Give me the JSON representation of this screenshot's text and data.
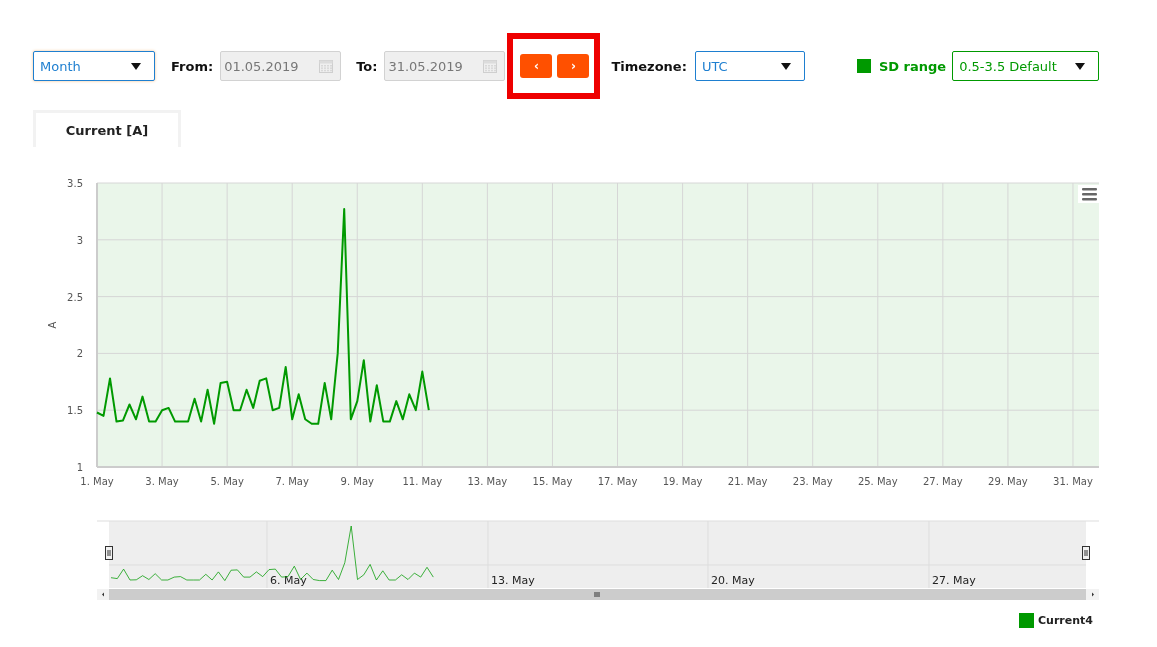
{
  "toolbar": {
    "period": {
      "value": "Month"
    },
    "from": {
      "label": "From:",
      "value": "01.05.2019"
    },
    "to": {
      "label": "To:",
      "value": "31.05.2019"
    },
    "nav_buttons": [
      {
        "label": "‹"
      },
      {
        "label": "›"
      }
    ],
    "annotation": {
      "kind": "frame",
      "color": "#ee0000"
    },
    "timezone": {
      "label": "Timezone:",
      "value": "UTC"
    },
    "sd_range": {
      "label": "SD range",
      "color": "#009900",
      "value": "0.5-3.5 Default"
    }
  },
  "tabs": [
    {
      "label": "Current [A]",
      "selected": true
    }
  ],
  "main_chart": {
    "chart_data": {
      "type": "line",
      "grid": true,
      "ylabel": "A",
      "ylim": [
        1,
        3.5
      ],
      "yticks": [
        1,
        1.5,
        2,
        2.5,
        3,
        3.5
      ],
      "categories": [
        "1. May",
        null,
        null,
        null,
        null,
        null,
        null,
        null,
        null,
        null,
        "3. May",
        null,
        null,
        null,
        null,
        null,
        null,
        null,
        null,
        null,
        "5. May",
        null,
        null,
        null,
        null,
        null,
        null,
        null,
        null,
        null,
        "7. May",
        null,
        null,
        null,
        null,
        null,
        null,
        null,
        null,
        null,
        "9. May",
        null,
        null,
        null,
        null,
        null,
        null,
        null,
        null,
        null,
        "11. May",
        null,
        null,
        null,
        null,
        null,
        null,
        null,
        null,
        null,
        "13. May",
        null,
        null,
        null,
        null,
        null,
        null,
        null,
        null,
        null,
        "15. May",
        null,
        null,
        null,
        null,
        null,
        null,
        null,
        null,
        null,
        "17. May",
        null,
        null,
        null,
        null,
        null,
        null,
        null,
        null,
        null,
        "19. May",
        null,
        null,
        null,
        null,
        null,
        null,
        null,
        null,
        null,
        "21. May",
        null,
        null,
        null,
        null,
        null,
        null,
        null,
        null,
        null,
        "23. May",
        null,
        null,
        null,
        null,
        null,
        null,
        null,
        null,
        null,
        "25. May",
        null,
        null,
        null,
        null,
        null,
        null,
        null,
        null,
        null,
        "27. May",
        null,
        null,
        null,
        null,
        null,
        null,
        null,
        null,
        null,
        "29. May",
        null,
        null,
        null,
        null,
        null,
        null,
        null,
        null,
        null,
        "31. May",
        null,
        null,
        null,
        null
      ],
      "series": [
        {
          "name": "Current4",
          "color": "#009900",
          "values": [
            1.48,
            1.45,
            1.78,
            1.4,
            1.41,
            1.55,
            1.42,
            1.62,
            1.4,
            1.4,
            1.5,
            1.52,
            1.4,
            1.4,
            1.4,
            1.6,
            1.4,
            1.68,
            1.38,
            1.74,
            1.75,
            1.5,
            1.5,
            1.68,
            1.52,
            1.76,
            1.78,
            1.5,
            1.52,
            1.88,
            1.42,
            1.64,
            1.42,
            1.38,
            1.38,
            1.74,
            1.42,
            2.0,
            3.27,
            1.42,
            1.58,
            1.94,
            1.4,
            1.72,
            1.4,
            1.4,
            1.58,
            1.42,
            1.64,
            1.5,
            1.84,
            1.5,
            null,
            null,
            null,
            null,
            null,
            null,
            null,
            null,
            null,
            null,
            null,
            null,
            null,
            null,
            null,
            null,
            null,
            null,
            null,
            null,
            null,
            null,
            null,
            null,
            null,
            null,
            null,
            null,
            null,
            null,
            null,
            null,
            null,
            null,
            null,
            null,
            null,
            null,
            null,
            null,
            null,
            null,
            null,
            null,
            null,
            null,
            null,
            null,
            null,
            null,
            null,
            null,
            null,
            null,
            null,
            null,
            null,
            null,
            null,
            null,
            null,
            null,
            null,
            null,
            null,
            null,
            null,
            null,
            null,
            null,
            null,
            null,
            null,
            null,
            null,
            null,
            null,
            null,
            null,
            null,
            null,
            null,
            null,
            null,
            null,
            null,
            null,
            null,
            null,
            null,
            null,
            null,
            null,
            null,
            null,
            null,
            null,
            null,
            null,
            null,
            null,
            null,
            null
          ]
        }
      ]
    }
  },
  "navigator": {
    "labels": [
      "6. May",
      "13. May",
      "20. May",
      "27. May"
    ]
  }
}
